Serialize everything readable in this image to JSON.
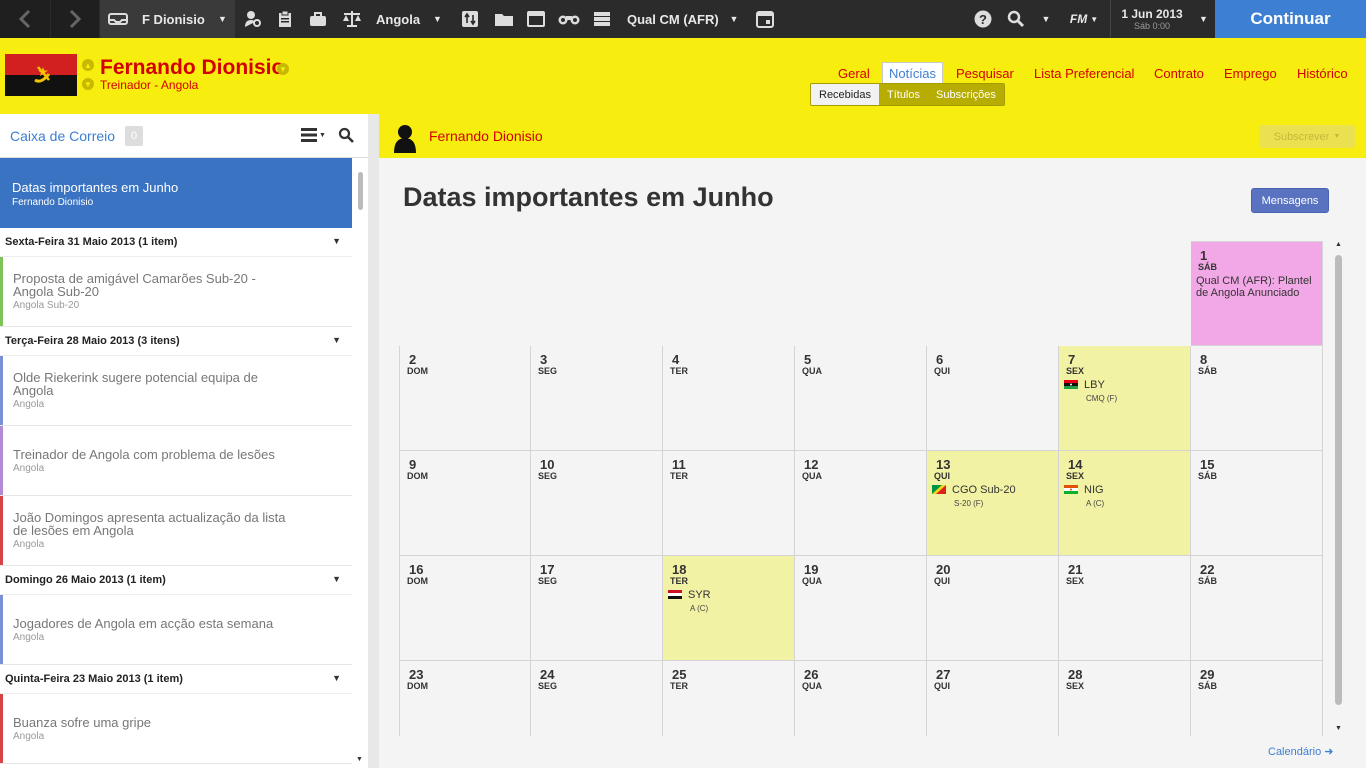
{
  "topbar": {
    "back_icon": "chevron-left-icon",
    "forward_icon": "chevron-right-icon",
    "manager_label": "F Dionisio",
    "nation_label": "Angola",
    "competition_label": "Qual CM (AFR)",
    "date_line1": "1 Jun 2013",
    "date_line2": "Sáb 0:00",
    "fm_label": "FM",
    "continue_label": "Continuar",
    "colors": {
      "bar": "#2b2b2b",
      "continue": "#3d7fd3"
    }
  },
  "header": {
    "name": "Fernando Dionisio",
    "subtitle": "Treinador - Angola",
    "nav": [
      "Geral",
      "Notícias",
      "Pesquisar",
      "Lista Preferencial",
      "Contrato",
      "Emprego",
      "Histórico"
    ],
    "active_nav": "Notícias",
    "subtabs": [
      "Recebidas",
      "Títulos",
      "Subscrições"
    ],
    "active_subtab": "Recebidas",
    "colors": {
      "background": "#f7ee10",
      "text": "#d40000"
    }
  },
  "sidebar": {
    "title": "Caixa de Correio",
    "count": "0",
    "selected": {
      "title": "Datas importantes em Junho",
      "sub": "Fernando Dionisio"
    },
    "groups": [
      {
        "header": "Sexta-Feira 31 Maio 2013 (1 item)",
        "items": [
          {
            "title": "Proposta de amigável Camarões Sub-20 - Angola Sub-20",
            "sub": "Angola Sub-20",
            "color": "#7dc35a"
          }
        ]
      },
      {
        "header": "Terça-Feira 28 Maio 2013 (3 itens)",
        "items": [
          {
            "title": "Olde Riekerink sugere potencial equipa de Angola",
            "sub": "Angola",
            "color": "#7a8fd6"
          },
          {
            "title": "Treinador de Angola com problema de lesões",
            "sub": "Angola",
            "color": "#b38ad6"
          },
          {
            "title": "João Domingos apresenta actualização da lista de lesões em Angola",
            "sub": "Angola",
            "color": "#d64545"
          }
        ]
      },
      {
        "header": "Domingo 26 Maio 2013 (1 item)",
        "items": [
          {
            "title": "Jogadores de Angola em acção esta semana",
            "sub": "Angola",
            "color": "#7a8fd6"
          }
        ]
      },
      {
        "header": "Quinta-Feira 23 Maio 2013 (1 item)",
        "items": [
          {
            "title": "Buanza sofre uma gripe",
            "sub": "Angola",
            "color": "#d64545"
          }
        ]
      }
    ]
  },
  "main": {
    "header_name": "Fernando Dionisio",
    "subscribe_label": "Subscrever",
    "title": "Datas importantes em Junho",
    "messages_button": "Mensagens",
    "calendar_link": "Calendário"
  },
  "calendar": {
    "days": [
      {
        "n": "1",
        "d": "SÁB",
        "style": "pink",
        "text": "Qual CM (AFR): Plantel de Angola Anunciado"
      },
      {
        "n": "2",
        "d": "DOM"
      },
      {
        "n": "3",
        "d": "SEG"
      },
      {
        "n": "4",
        "d": "TER"
      },
      {
        "n": "5",
        "d": "QUA"
      },
      {
        "n": "6",
        "d": "QUI"
      },
      {
        "n": "7",
        "d": "SEX",
        "style": "yel",
        "team": "LBY",
        "sub": "CMQ (F)",
        "flag": "libya"
      },
      {
        "n": "8",
        "d": "SÁB"
      },
      {
        "n": "9",
        "d": "DOM"
      },
      {
        "n": "10",
        "d": "SEG"
      },
      {
        "n": "11",
        "d": "TER"
      },
      {
        "n": "12",
        "d": "QUA"
      },
      {
        "n": "13",
        "d": "QUI",
        "style": "yel",
        "team": "CGO Sub-20",
        "sub": "S-20 (F)",
        "flag": "congo"
      },
      {
        "n": "14",
        "d": "SEX",
        "style": "yel",
        "team": "NIG",
        "sub": "A (C)",
        "flag": "niger"
      },
      {
        "n": "15",
        "d": "SÁB"
      },
      {
        "n": "16",
        "d": "DOM"
      },
      {
        "n": "17",
        "d": "SEG"
      },
      {
        "n": "18",
        "d": "TER",
        "style": "yel",
        "team": "SYR",
        "sub": "A (C)",
        "flag": "syria"
      },
      {
        "n": "19",
        "d": "QUA"
      },
      {
        "n": "20",
        "d": "QUI"
      },
      {
        "n": "21",
        "d": "SEX"
      },
      {
        "n": "22",
        "d": "SÁB"
      },
      {
        "n": "23",
        "d": "DOM"
      },
      {
        "n": "24",
        "d": "SEG"
      },
      {
        "n": "25",
        "d": "TER"
      },
      {
        "n": "26",
        "d": "QUA"
      },
      {
        "n": "27",
        "d": "QUI"
      },
      {
        "n": "28",
        "d": "SEX"
      },
      {
        "n": "29",
        "d": "SÁB"
      }
    ]
  }
}
